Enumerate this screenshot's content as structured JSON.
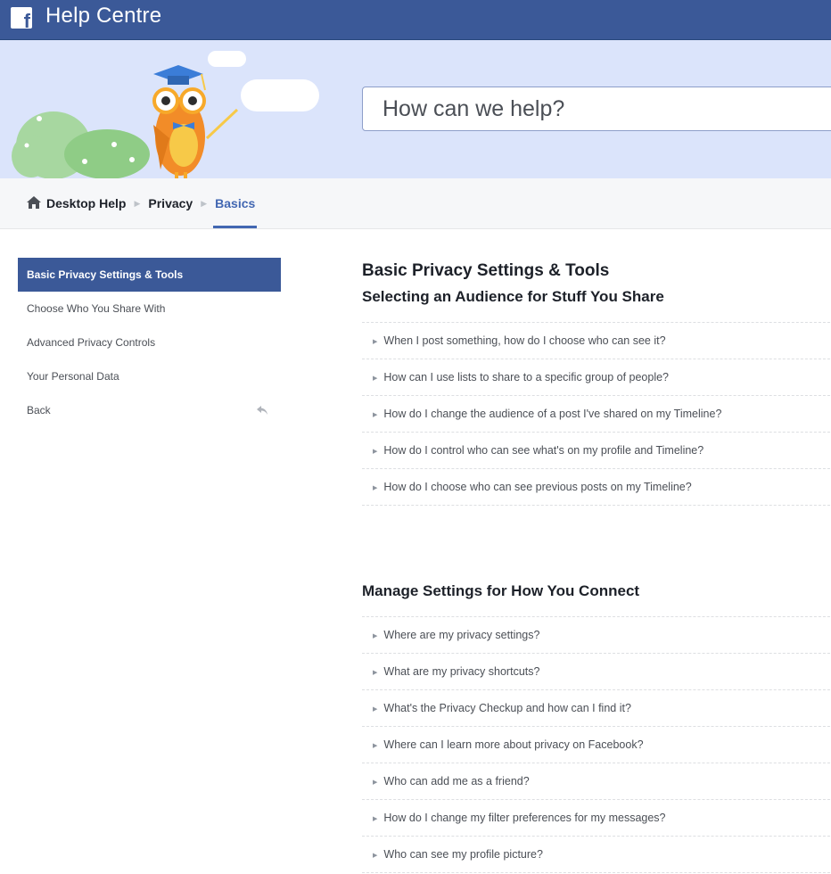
{
  "header": {
    "title": "Help Centre",
    "logo_icon": "facebook-f-icon"
  },
  "hero": {
    "search_placeholder": "How can we help?"
  },
  "breadcrumb": {
    "items": [
      "Desktop Help",
      "Privacy",
      "Basics"
    ],
    "home_icon": "home-icon"
  },
  "sidebar": {
    "items": [
      {
        "label": "Basic Privacy Settings & Tools",
        "active": true
      },
      {
        "label": "Choose Who You Share With"
      },
      {
        "label": "Advanced Privacy Controls"
      },
      {
        "label": "Your Personal Data"
      },
      {
        "label": "Back",
        "icon": "back-arrow-icon"
      }
    ]
  },
  "main": {
    "title": "Basic Privacy Settings & Tools",
    "sections": [
      {
        "title": "Selecting an Audience for Stuff You Share",
        "questions": [
          "When I post something, how do I choose who can see it?",
          "How can I use lists to share to a specific group of people?",
          "How do I change the audience of a post I've shared on my Timeline?",
          "How do I control who can see what's on my profile and Timeline?",
          "How do I choose who can see previous posts on my Timeline?"
        ]
      },
      {
        "title": "Manage Settings for How You Connect",
        "questions": [
          "Where are my privacy settings?",
          "What are my privacy shortcuts?",
          "What's the Privacy Checkup and how can I find it?",
          "Where can I learn more about privacy on Facebook?",
          "Who can add me as a friend?",
          "How do I change my filter preferences for my messages?",
          "Who can see my profile picture?"
        ]
      }
    ]
  },
  "colors": {
    "brand": "#3b5998",
    "link_accent": "#4267b2",
    "hero_bg": "#dbe4fb"
  }
}
